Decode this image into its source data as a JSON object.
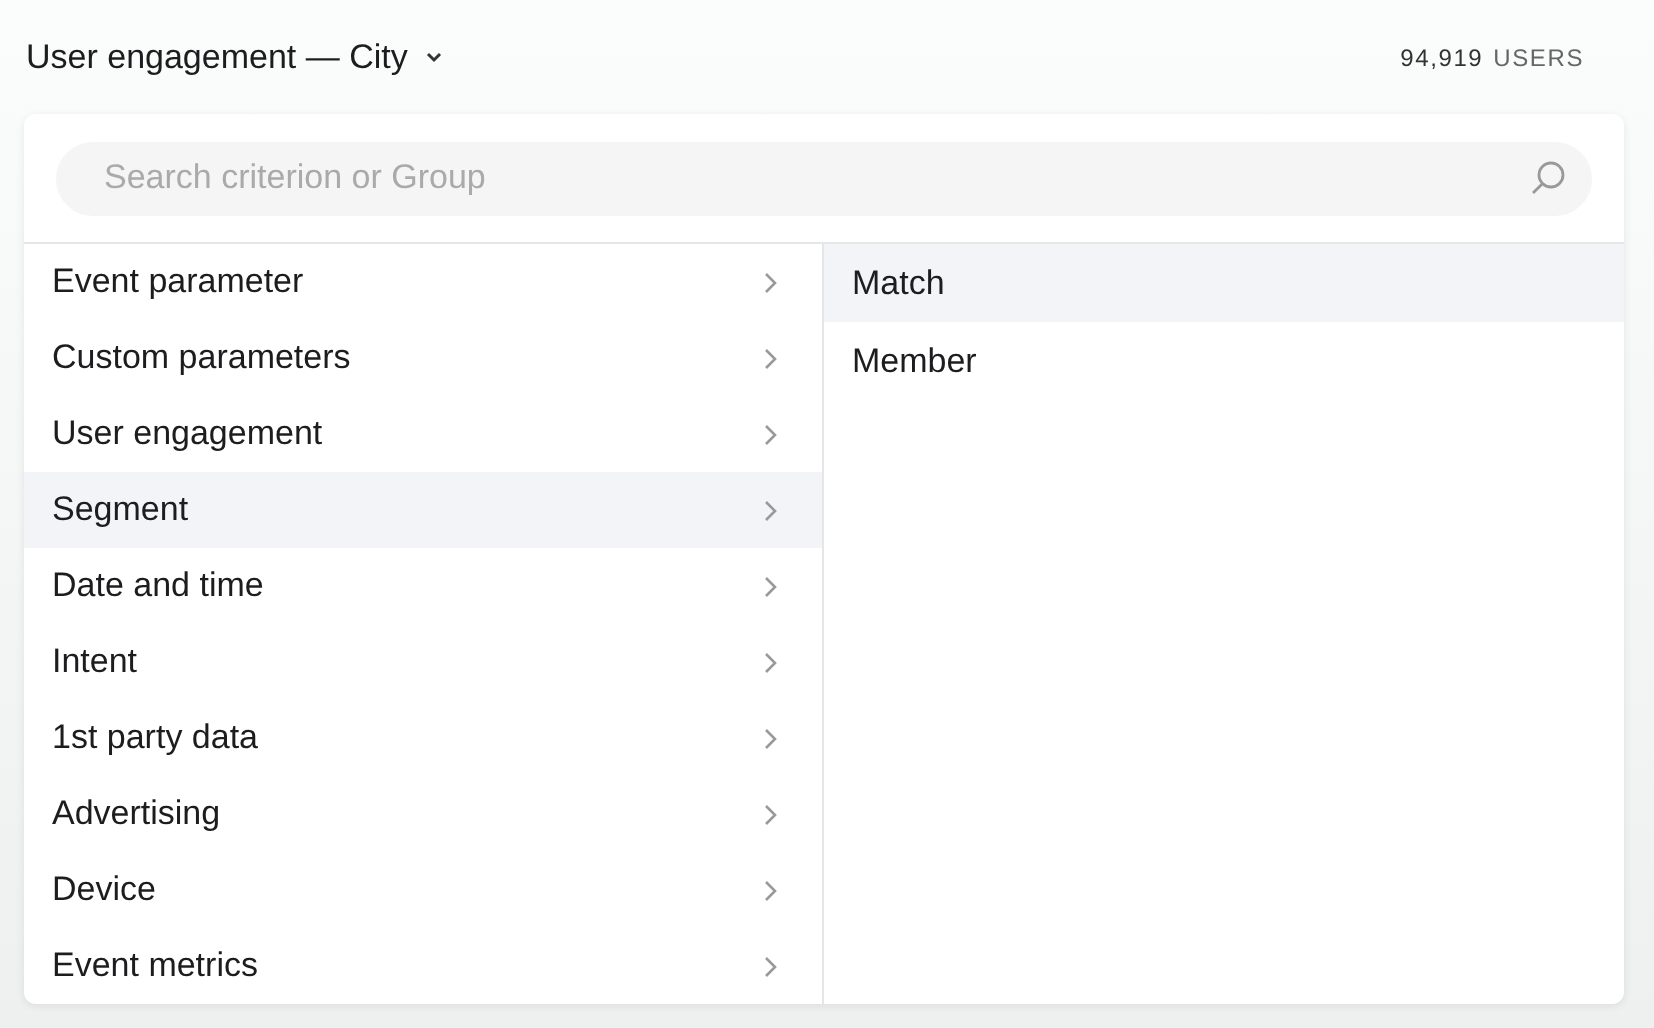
{
  "header": {
    "title": "User engagement — City",
    "count": "94,919",
    "count_unit": "USERS"
  },
  "search": {
    "placeholder": "Search criterion or Group"
  },
  "categories": [
    {
      "label": "Event parameter",
      "selected": false
    },
    {
      "label": "Custom parameters",
      "selected": false
    },
    {
      "label": "User engagement",
      "selected": false
    },
    {
      "label": "Segment",
      "selected": true
    },
    {
      "label": "Date and time",
      "selected": false
    },
    {
      "label": "Intent",
      "selected": false
    },
    {
      "label": "1st party data",
      "selected": false
    },
    {
      "label": "Advertising",
      "selected": false
    },
    {
      "label": "Device",
      "selected": false
    },
    {
      "label": "Event metrics",
      "selected": false
    }
  ],
  "options": [
    {
      "label": "Match",
      "selected": true
    },
    {
      "label": "Member",
      "selected": false
    }
  ]
}
